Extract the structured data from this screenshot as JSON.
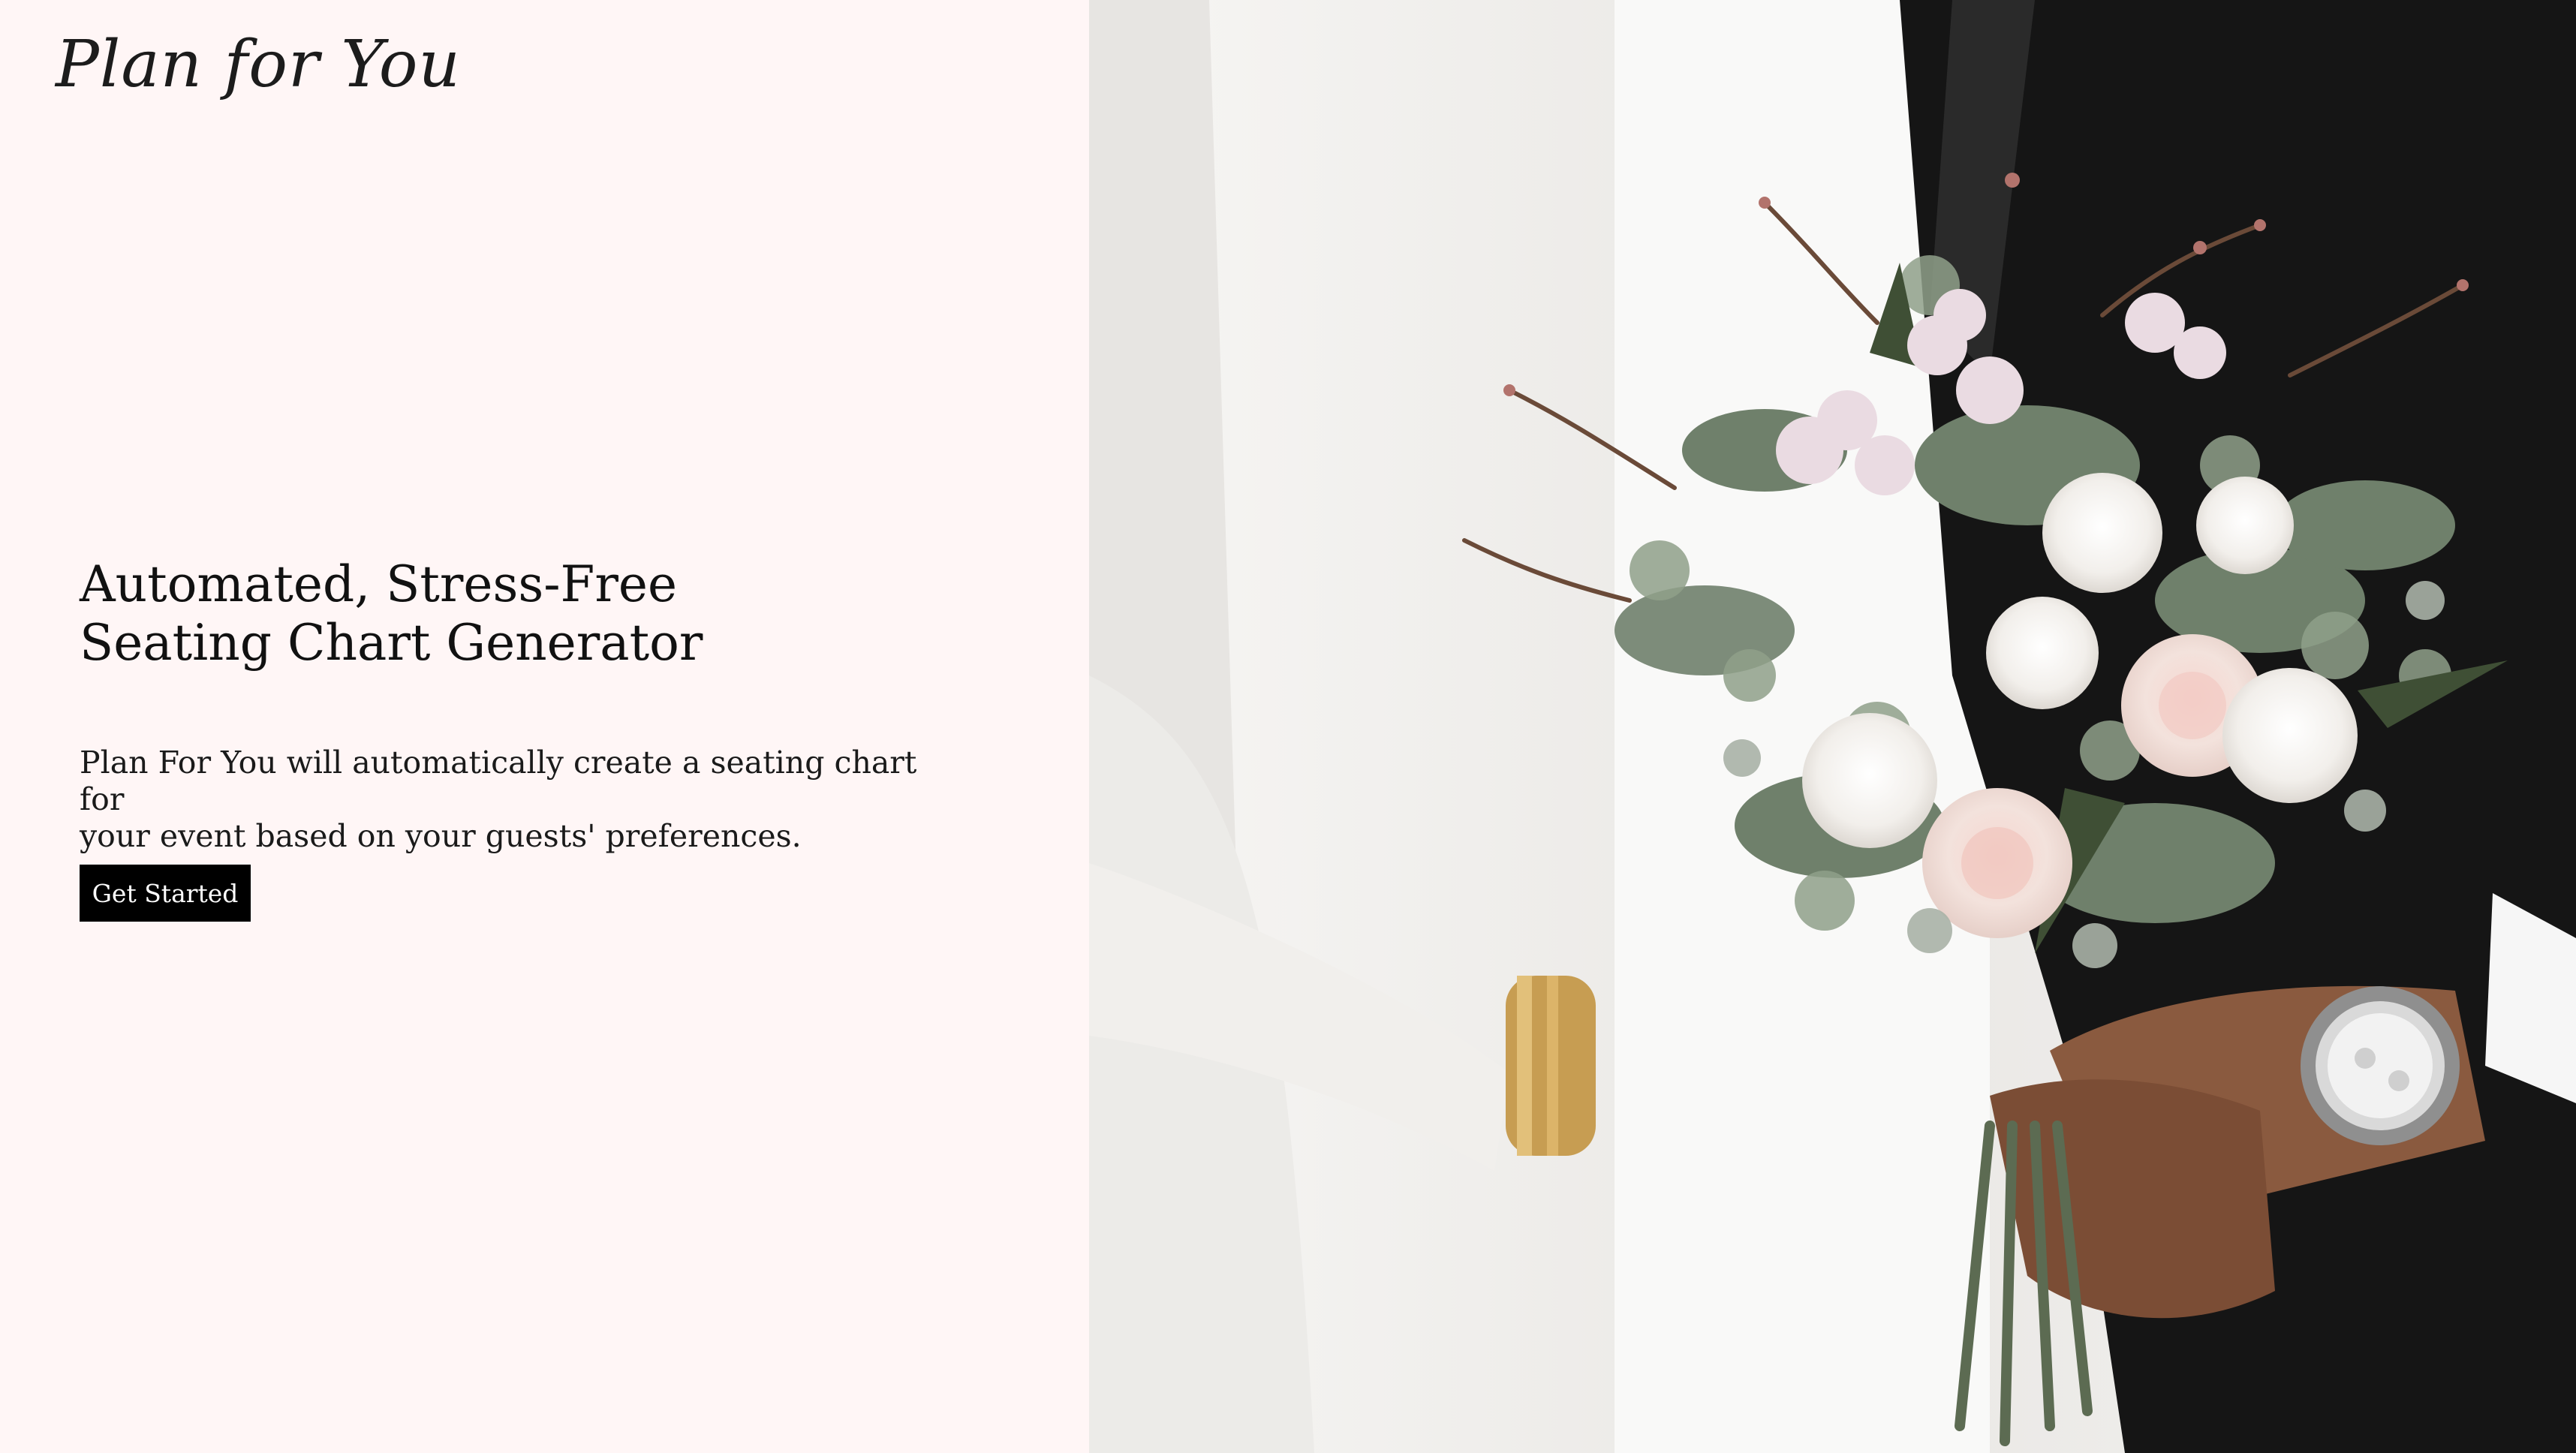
{
  "brand": {
    "logo_text": "Plan for You"
  },
  "hero": {
    "title_line1": "Automated, Stress-Free",
    "title_line2": "Seating Chart Generator",
    "description_line1": "Plan For You will automatically create a seating chart for",
    "description_line2": "your event based on your guests' preferences.",
    "cta_label": "Get Started"
  },
  "colors": {
    "left_background": "#fff6f6",
    "button_background": "#000000",
    "button_text": "#ffffff",
    "text": "#111111"
  },
  "image": {
    "subject_icon": "wedding-bouquet-photo"
  }
}
